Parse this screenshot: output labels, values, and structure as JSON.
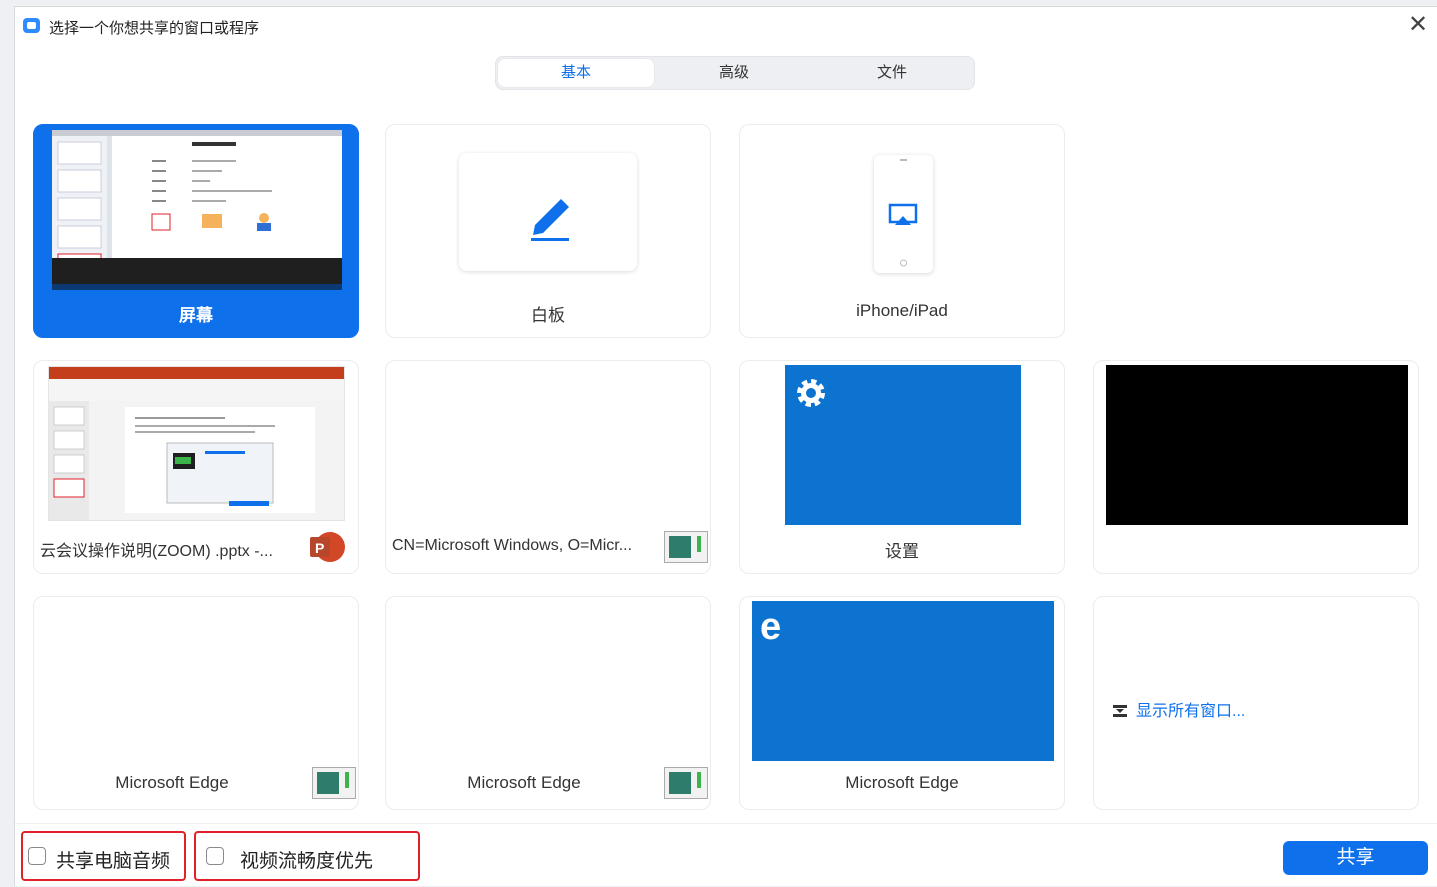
{
  "window": {
    "title": "选择一个你想共享的窗口或程序"
  },
  "tabs": [
    {
      "label": "基本",
      "active": true
    },
    {
      "label": "高级",
      "active": false
    },
    {
      "label": "文件",
      "active": false
    }
  ],
  "tiles": [
    {
      "label": "屏幕",
      "selected": true
    },
    {
      "label": "白板"
    },
    {
      "label": "iPhone/iPad"
    },
    {
      "label": "云会议操作说明(ZOOM) .pptx -..."
    },
    {
      "label": "CN=Microsoft Windows, O=Micr..."
    },
    {
      "label": "设置"
    },
    {
      "label": ""
    },
    {
      "label": "Microsoft Edge"
    },
    {
      "label": "Microsoft Edge"
    },
    {
      "label": "Microsoft Edge"
    },
    {
      "label": "显示所有窗口..."
    }
  ],
  "options": {
    "share_audio": {
      "label": "共享电脑音频",
      "checked": false
    },
    "video_smooth": {
      "label": "视频流畅度优先",
      "checked": false
    }
  },
  "share_button": {
    "label": "共享"
  },
  "colors": {
    "accent": "#0e71eb",
    "highlight_border": "#e0202a",
    "tile_blue": "#0c73d1"
  },
  "icons": {
    "app": "zoom-logo-icon",
    "close": "close-icon",
    "whiteboard": "pencil-icon",
    "airplay": "airplay-icon",
    "powerpoint": "powerpoint-icon",
    "app_window": "app-window-icon",
    "settings": "gear-icon",
    "edge": "edge-icon",
    "show_all": "show-all-windows-icon"
  }
}
